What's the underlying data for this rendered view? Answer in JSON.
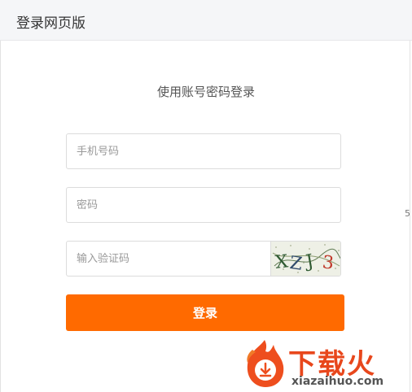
{
  "header": {
    "title": "登录网页版"
  },
  "login": {
    "subtitle": "使用账号密码登录",
    "phone_placeholder": "手机号码",
    "password_placeholder": "密码",
    "captcha_placeholder": "输入验证码",
    "captcha_text": "XZJ3",
    "submit_label": "登录"
  },
  "edge_text": "5",
  "watermark": {
    "brand": "下载火",
    "domain": "xiazaihuo.com"
  },
  "colors": {
    "accent": "#ff6a00",
    "header_bg": "#f5f6f8",
    "watermark": "#e8471c"
  }
}
